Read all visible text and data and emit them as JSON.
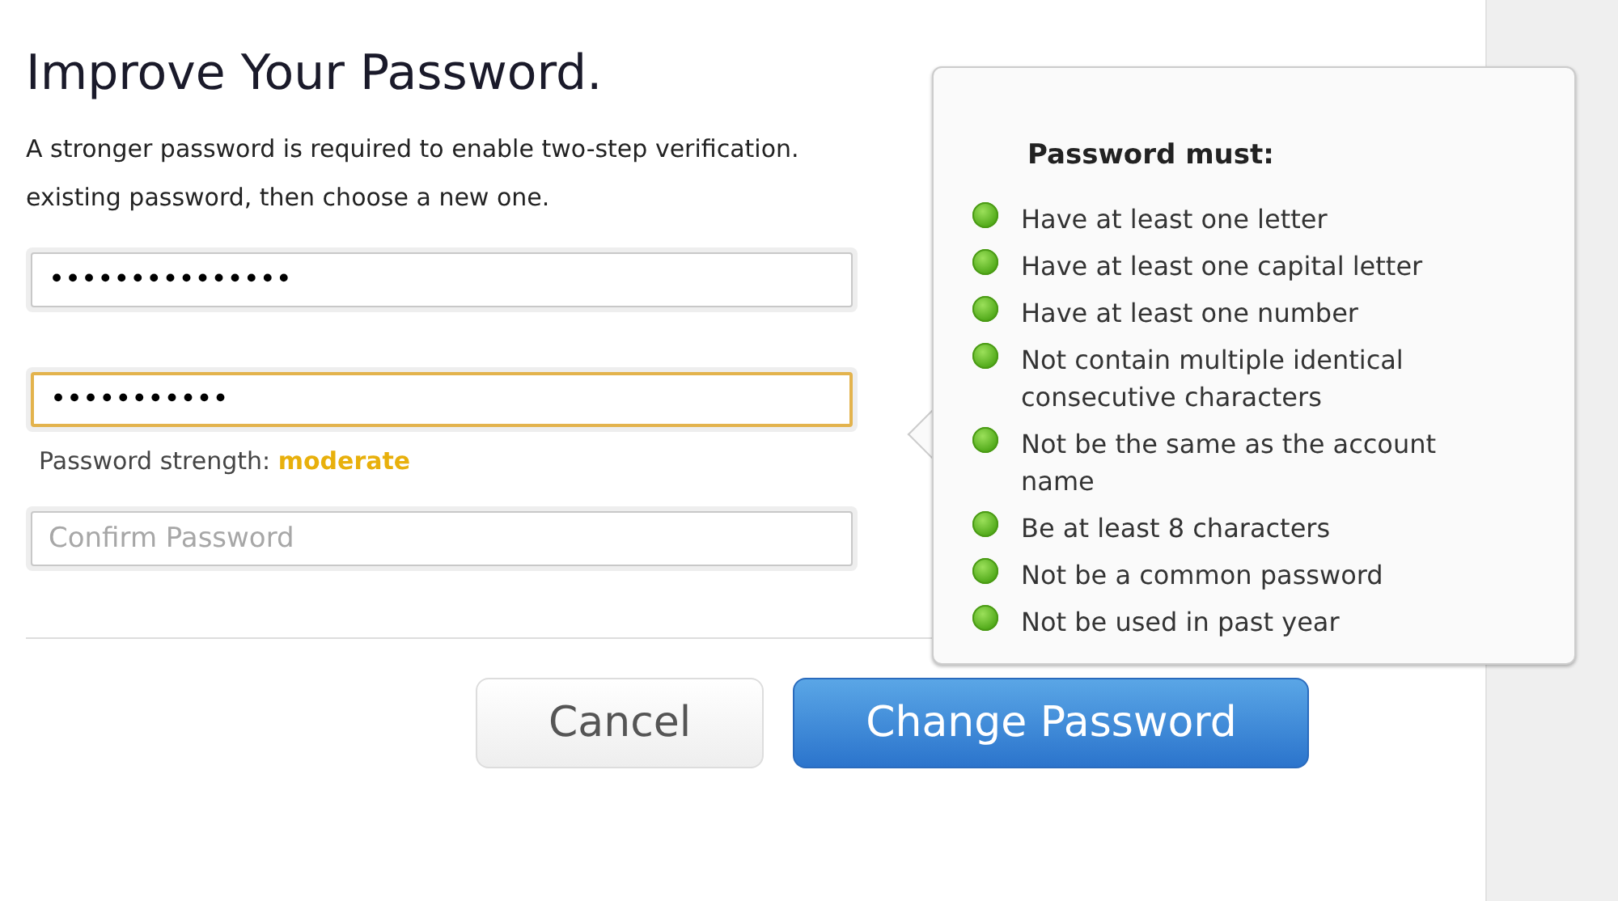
{
  "title": "Improve Your Password.",
  "description_lines": [
    "A stronger password is required to enable two-step verification.",
    "existing password, then choose a new one."
  ],
  "fields": [
    {
      "kind": "password",
      "value": "•••••••••••••••",
      "focused": false
    },
    {
      "kind": "password",
      "value": "•••••••••••",
      "focused": true
    },
    {
      "kind": "confirm",
      "placeholder": "Confirm Password",
      "focused": false
    }
  ],
  "strength": {
    "label": "Password strength:",
    "value": "moderate",
    "color": "#e8b00c"
  },
  "buttons": [
    {
      "kind": "secondary",
      "label": "Cancel"
    },
    {
      "kind": "primary",
      "label": "Change Password"
    }
  ],
  "popover": {
    "heading": "Password must:",
    "rules": [
      {
        "text": "Have at least one letter",
        "met": true
      },
      {
        "text": "Have at least one capital letter",
        "met": true
      },
      {
        "text": "Have at least one number",
        "met": true
      },
      {
        "text": "Not contain multiple identical consecutive characters",
        "met": true
      },
      {
        "text": "Not be the same as the account name",
        "met": true
      },
      {
        "text": "Be at least 8 characters",
        "met": true
      },
      {
        "text": "Not be a common password",
        "met": true
      },
      {
        "text": "Not be used in past year",
        "met": true
      }
    ]
  }
}
